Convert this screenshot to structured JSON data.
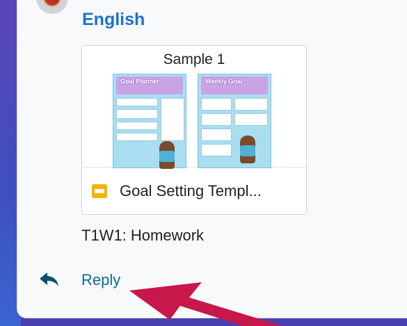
{
  "post": {
    "subject": "English",
    "attachment": {
      "preview_title": "Sample 1",
      "sheet_left_title": "Goal Planner",
      "sheet_right_title": "Weekly Goal",
      "file_name": "Goal Setting Templ..."
    },
    "note": "T1W1: Homework",
    "reply_label": "Reply"
  },
  "icons": {
    "avatar": "avatar",
    "doc": "google-slides-icon",
    "reply": "reply-arrow-icon",
    "annotation": "red-arrow"
  },
  "colors": {
    "background": "#4a3fb0",
    "card": "#f8f9fb",
    "subject": "#1a73c8",
    "reply": "#0b6a8f",
    "doc_icon": "#f4b400",
    "arrow": "#c8174a"
  }
}
